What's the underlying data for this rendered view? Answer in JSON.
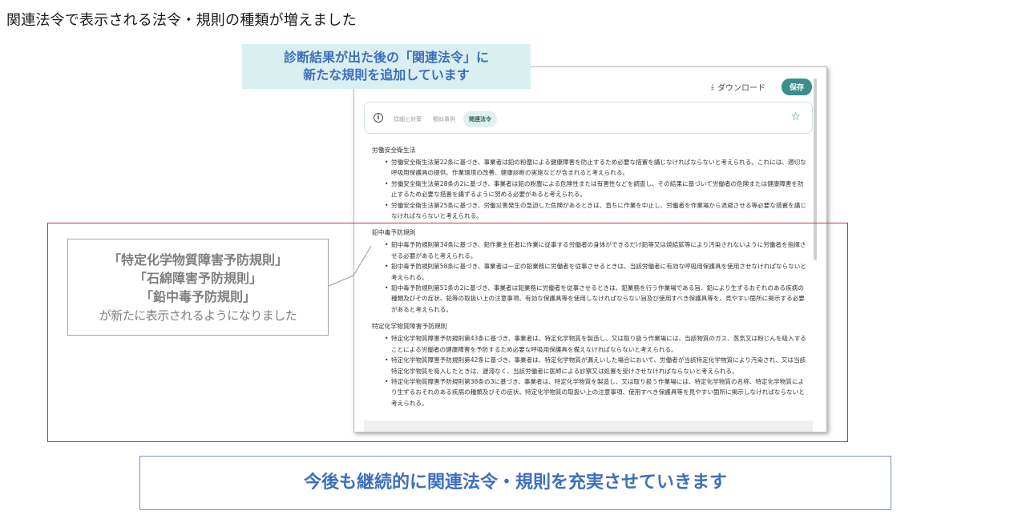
{
  "slide": {
    "title": "関連法令で表示される法令・規則の種類が増えました",
    "callout_top": [
      "診断結果が出た後の「関連法令」に",
      "新たな規則を追加しています"
    ],
    "annotation": {
      "lines": [
        "「特定化学物質障害予防規則」",
        "「石綿障害予防規則」",
        "「鉛中毒予防規則」"
      ],
      "note": "が新たに表示されるようになりました"
    },
    "footer": "今後も継続的に関連法令・規則を充実させていきます"
  },
  "app": {
    "toolbar": {
      "download_icon": "download-icon",
      "download_label": "ダウンロード",
      "save_label": "保存"
    },
    "info_icon_glyph": "①",
    "tabs": [
      {
        "label": "詳細と対策",
        "active": false
      },
      {
        "label": "類似事例",
        "active": false
      },
      {
        "label": "関連法令",
        "active": true
      }
    ],
    "star_icon": "☆",
    "sections": [
      {
        "heading": "労働安全衛生法",
        "items": [
          "労働安全衛生法第22条に基づき、事業者は鉛の粉塵による健康障害を防止するため必要な措置を講じなければならないと考えられる。これには、適切な呼吸用保護具の提供、作業環境の改善、健康診断の実施などが含まれると考えられる。",
          "労働安全衛生法第28条の2に基づき、事業者は鉛の粉塵による危険性または有害性などを調査し、その結果に基づいて労働者の危険または健康障害を防止するため必要な措置を講ずるように努める必要があると考えられる。",
          "労働安全衛生法第25条に基づき、労働災害発生の急迫した危険があるときは、直ちに作業を中止し、労働者を作業場から退避させる等必要な措置を講じなければならないと考えられる。"
        ]
      },
      {
        "heading": "鉛中毒予防規則",
        "items": [
          "鉛中毒予防規則第34条に基づき、鉛作業主任者に作業に従事する労働者の身体ができるだけ鉛等又は焼結鉱等により汚染されないように労働者を指揮させる必要があると考えられる。",
          "鉛中毒予防規則第58条に基づき、事業者は一定の鉛業務に労働者を従事させるときは、当該労働者に有効な呼吸用保護具を使用させなければならないと考えられる。",
          "鉛中毒予防規則第51条の2に基づき、事業者は鉛業務に労働者を従事させるときは、鉛業務を行う作業場である旨、鉛により生ずるおそれのある疾病の種類及びその症状、鉛等の取扱い上の注意事項、有効な保護具等を使用しなければならない旨及び使用すべき保護具等を、見やすい箇所に掲示する必要があると考えられる。"
        ]
      },
      {
        "heading": "特定化学物質障害予防規則",
        "items": [
          "特定化学物質障害予防規則第43条に基づき、事業者は、特定化学物質を製造し、又は取り扱う作業場には、当該物質のガス、蒸気又は粉じんを吸入することによる労働者の健康障害を予防するため必要な呼吸用保護具を備えなければならないと考えられる。",
          "特定化学物質障害予防規則第42条に基づき、事業者は、特定化学物質が漏えいした場合において、労働者が当該特定化学物質により汚染され、又は当該特定化学物質を吸入したときは、遅滞なく、当該労働者に医師による診察又は処置を受けさせなければならないと考えられる。",
          "特定化学物質障害予防規則第38条の3に基づき、事業者は、特定化学物質を製造し、又は取り扱う作業場には、特定化学物質の名称、特定化学物質により生ずるおそれのある疾病の種類及びその症状、特定化学物質の取扱い上の注意事項、使用すべき保護具等を見やすい箇所に掲示しなければならないと考えられる。"
        ]
      }
    ]
  },
  "colors": {
    "accent_blue": "#3d6fbf",
    "callout_bg": "#d9eff0",
    "save_teal": "#3a8f8d",
    "frame_red": "#c0393b",
    "annotation_gray": "#7f7f7f"
  }
}
